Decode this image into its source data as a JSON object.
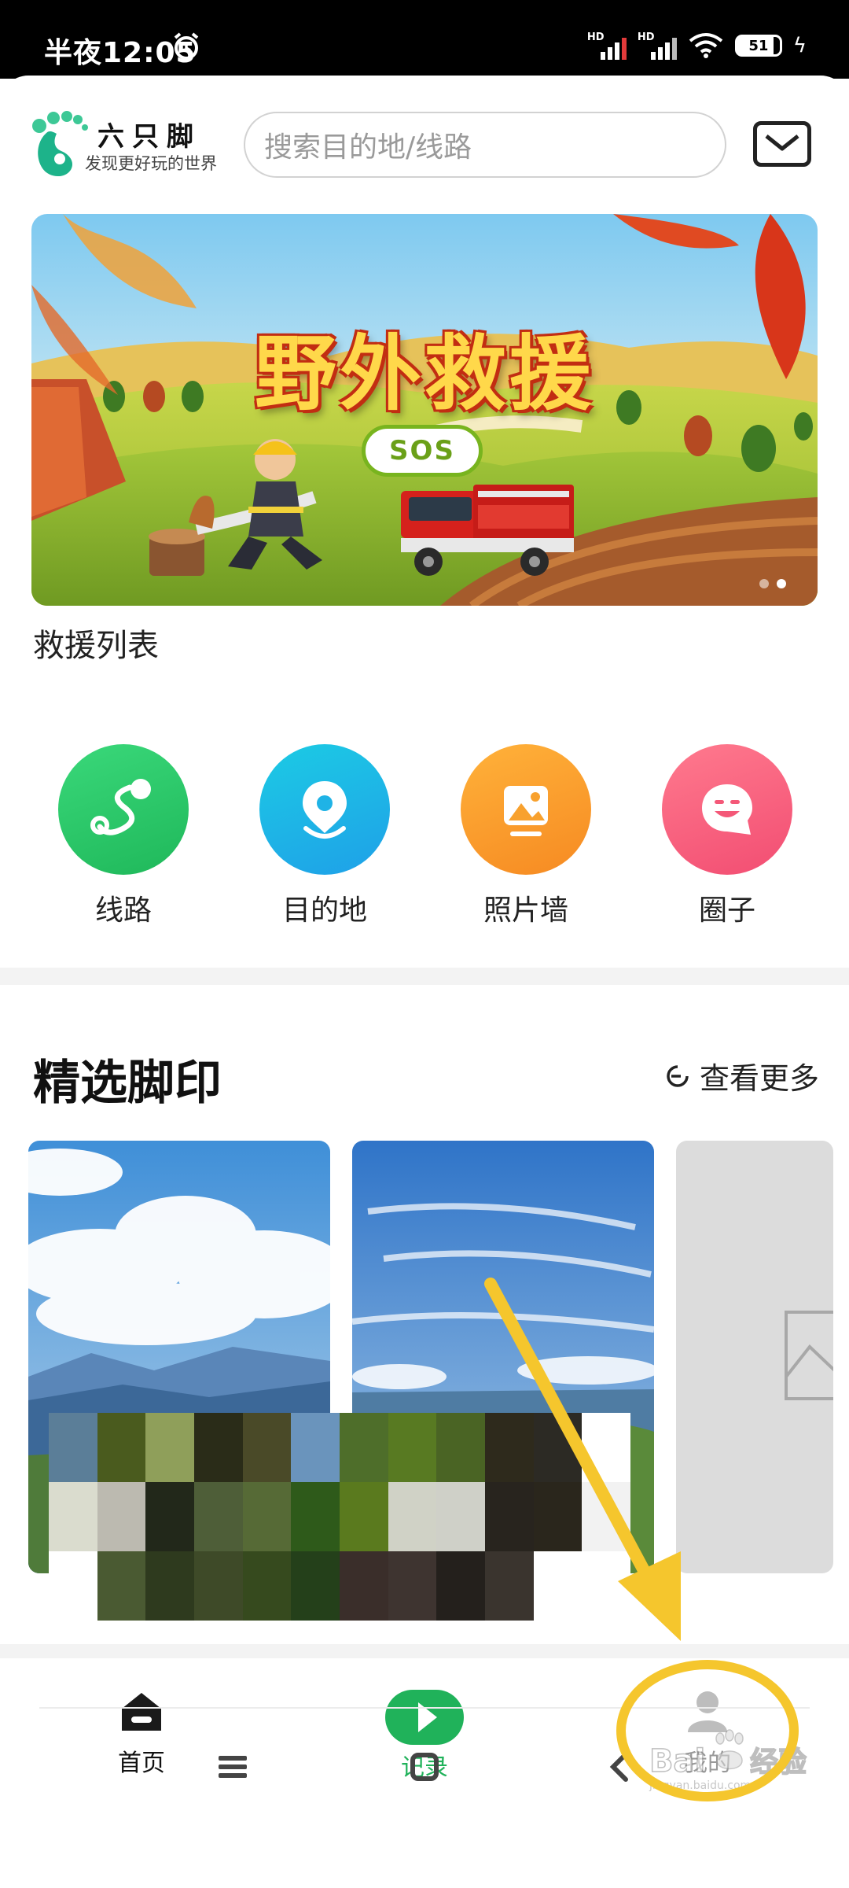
{
  "status_bar": {
    "time": "半夜12:05",
    "network_labels": [
      "HD",
      "HD"
    ],
    "battery": "51"
  },
  "header": {
    "brand_name": "六只脚",
    "brand_slogan": "发现更好玩的世界",
    "search_placeholder": "搜索目的地/线路"
  },
  "banner": {
    "title": "野外救援",
    "badge": "SOS",
    "slide_count": 2,
    "active_slide": 2
  },
  "rescue_list_label": "救援列表",
  "shortcuts": [
    {
      "label": "线路",
      "icon": "route-icon",
      "color": "#2ec866"
    },
    {
      "label": "目的地",
      "icon": "location-pin-icon",
      "color": "#1cb6e6"
    },
    {
      "label": "照片墙",
      "icon": "photo-icon",
      "color": "#f89a2a"
    },
    {
      "label": "圈子",
      "icon": "smile-chat-icon",
      "color": "#f5567a"
    }
  ],
  "featured": {
    "title": "精选脚印",
    "see_more": "查看更多"
  },
  "bottom_nav": [
    {
      "label": "首页",
      "icon": "home-icon",
      "active": false
    },
    {
      "label": "记录",
      "icon": "record-play-icon",
      "active": true
    },
    {
      "label": "我的",
      "icon": "profile-icon",
      "active": false
    }
  ],
  "watermark": {
    "text": "Baidu经验",
    "sub": "jingyan.baidu.com"
  },
  "colors": {
    "accent_green": "#20b25a",
    "annotation_yellow": "#f5c62d"
  }
}
